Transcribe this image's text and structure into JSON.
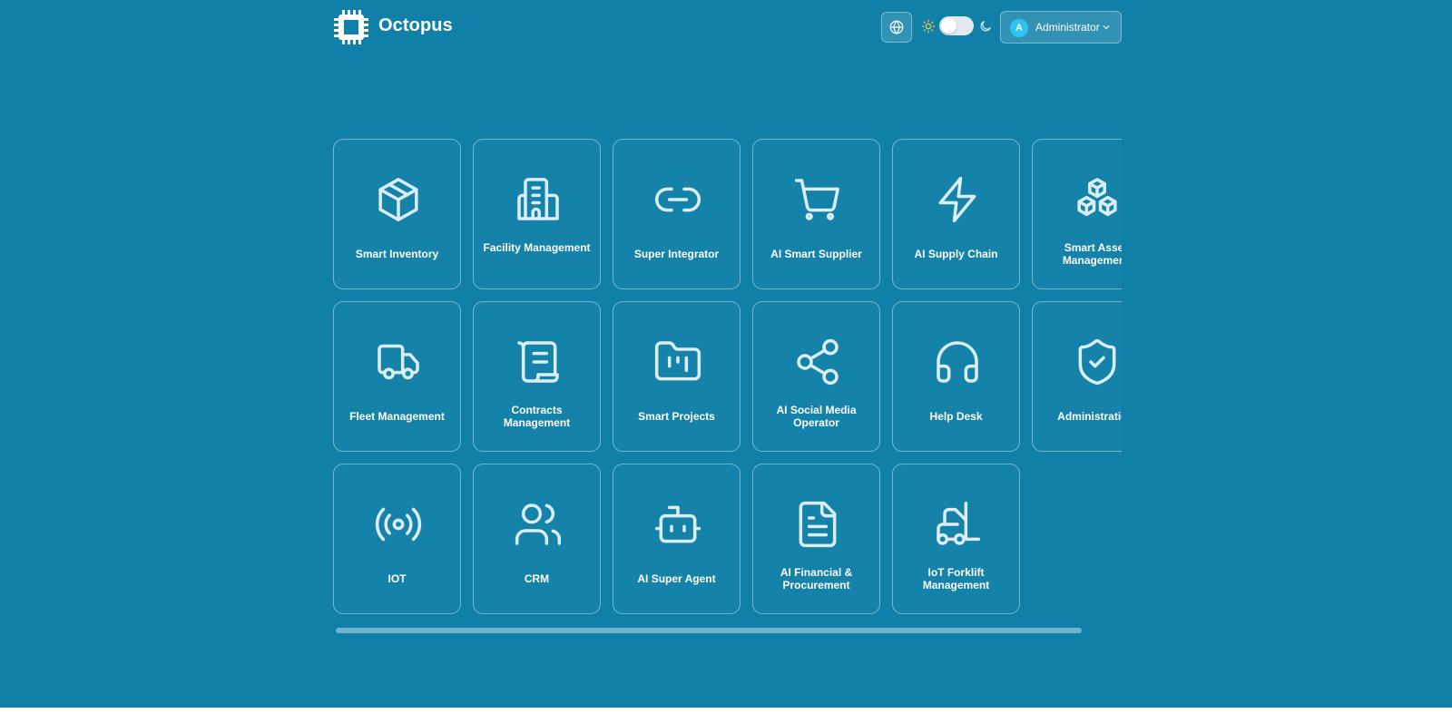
{
  "app": {
    "name": "Octopus"
  },
  "header": {
    "language_icon": "globe-icon",
    "theme_light_icon": "sun-icon",
    "theme_dark_icon": "moon-icon",
    "theme_toggle_on": false,
    "user": {
      "initial": "A",
      "name": "Administrator"
    }
  },
  "modules": [
    {
      "label": "Smart Inventory",
      "icon": "package-icon"
    },
    {
      "label": "Facility Management",
      "icon": "building-icon"
    },
    {
      "label": "Super Integrator",
      "icon": "link-icon"
    },
    {
      "label": "AI Smart Supplier",
      "icon": "shopping-cart-icon"
    },
    {
      "label": "AI Supply Chain",
      "icon": "lightning-icon"
    },
    {
      "label": "Smart Asset Management",
      "icon": "boxes-icon"
    },
    {
      "label": "Fleet Management",
      "icon": "truck-icon"
    },
    {
      "label": "Contracts Management",
      "icon": "scroll-icon"
    },
    {
      "label": "Smart Projects",
      "icon": "folder-kanban-icon"
    },
    {
      "label": "AI Social Media Operator",
      "icon": "share-icon"
    },
    {
      "label": "Help Desk",
      "icon": "headphones-icon"
    },
    {
      "label": "Administration",
      "icon": "shield-check-icon"
    },
    {
      "label": "IOT",
      "icon": "radio-signal-icon"
    },
    {
      "label": "CRM",
      "icon": "users-icon"
    },
    {
      "label": "AI Super Agent",
      "icon": "robot-icon"
    },
    {
      "label": "AI Financial & Procurement",
      "icon": "document-icon"
    },
    {
      "label": "IoT Forklift Management",
      "icon": "forklift-icon"
    }
  ],
  "colors": {
    "background": "#1180a8",
    "avatar": "#2ec3f2",
    "sun": "#f5c542"
  }
}
